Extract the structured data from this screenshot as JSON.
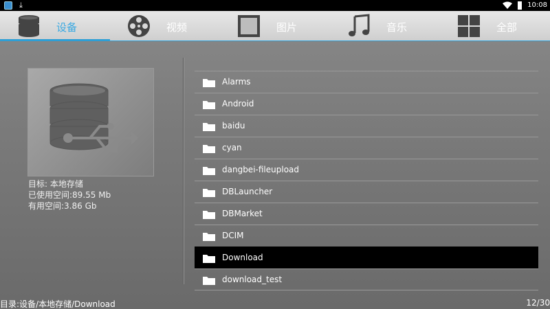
{
  "status_bar": {
    "time": "10:08",
    "icons": [
      "app-icon",
      "download-icon",
      "wifi-icon",
      "battery-icon"
    ]
  },
  "tabs": [
    {
      "label": "设备",
      "icon": "storage-icon",
      "active": true
    },
    {
      "label": "视频",
      "icon": "film-reel-icon",
      "active": false
    },
    {
      "label": "图片",
      "icon": "picture-frame-icon",
      "active": false
    },
    {
      "label": "音乐",
      "icon": "music-note-icon",
      "active": false
    },
    {
      "label": "全部",
      "icon": "grid-icon",
      "active": false
    }
  ],
  "device": {
    "target": "目标: 本地存储",
    "used": "已使用空间:89.55 Mb",
    "free": "有用空间:3.86 Gb",
    "icon": "usb-storage-icon"
  },
  "files": [
    {
      "name": "Alarms",
      "selected": false
    },
    {
      "name": "Android",
      "selected": false
    },
    {
      "name": "baidu",
      "selected": false
    },
    {
      "name": "cyan",
      "selected": false
    },
    {
      "name": "dangbei-fileupload",
      "selected": false
    },
    {
      "name": "DBLauncher",
      "selected": false
    },
    {
      "name": "DBMarket",
      "selected": false
    },
    {
      "name": "DCIM",
      "selected": false
    },
    {
      "name": "Download",
      "selected": true
    },
    {
      "name": "download_test",
      "selected": false
    }
  ],
  "footer": {
    "path": "目录:设备/本地存储/Download",
    "page": "12/30"
  },
  "colors": {
    "accent": "#2d9fd6",
    "selected_row": "#000000"
  }
}
